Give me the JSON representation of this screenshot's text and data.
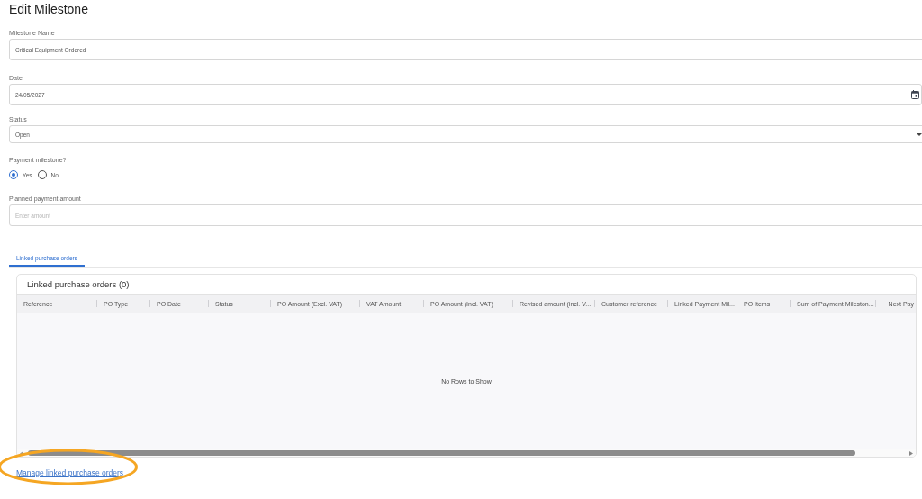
{
  "page": {
    "title": "Edit Milestone"
  },
  "form": {
    "fields": [
      {
        "kind": "text",
        "label": "Milestone Name",
        "value": "Critical Equipment Ordered"
      },
      {
        "kind": "date",
        "label": "Date",
        "value": "24/05/2027"
      },
      {
        "kind": "select",
        "label": "Status",
        "value": "Open"
      },
      {
        "kind": "radio",
        "label": "Payment milestone?",
        "options": [
          {
            "label": "Yes",
            "selected": true
          },
          {
            "label": "No",
            "selected": false
          }
        ]
      },
      {
        "kind": "text",
        "label": "Planned payment amount",
        "placeholder": "Enter amount"
      }
    ]
  },
  "tabs": [
    {
      "label": "Linked purchase orders",
      "selected": true
    }
  ],
  "grid": {
    "title": "Linked purchase orders (0)",
    "columns": [
      "Reference",
      "PO Type",
      "PO Date",
      "Status",
      "PO Amount (Excl. VAT)",
      "VAT Amount",
      "PO Amount (Incl. VAT)",
      "Revised amount (incl. V...",
      "Customer reference",
      "Linked Payment Mil...",
      "PO Items",
      "Sum of Payment Mileston...",
      "Next Pay"
    ],
    "empty_message": "No Rows to Show"
  },
  "link": {
    "label": "Manage linked purchase orders"
  },
  "annotation": {
    "kind": "ellipse"
  }
}
